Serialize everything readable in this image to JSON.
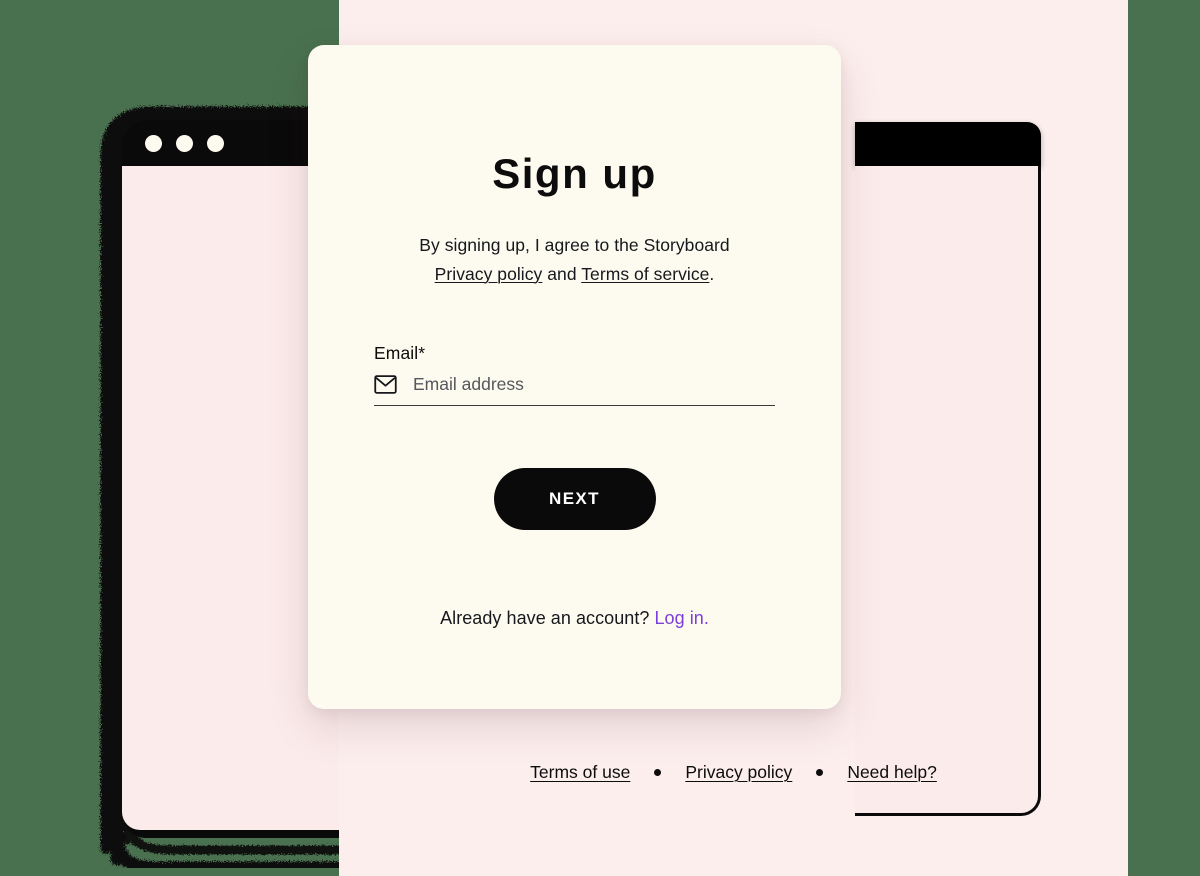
{
  "theme": {
    "page_background": "#4a714f",
    "panel_background": "#fdeeee",
    "card_background": "#fdfbef",
    "window_chrome": "#0a0a0a",
    "screen_background": "#fcebeb",
    "text_primary": "#0c0c0c",
    "link_accent": "#7b3fdc",
    "button_background": "#0a0a0a",
    "button_text": "#ffffff"
  },
  "back_window": {
    "name": "browser-window-back",
    "traffic_lights": [
      "close",
      "minimize",
      "maximize"
    ]
  },
  "front_window": {
    "name": "browser-window-front"
  },
  "card": {
    "title": "Sign up",
    "legal": {
      "lead": "By signing up, I agree to the Storyboard",
      "privacy_link": "Privacy policy",
      "conjunction": "and",
      "terms_link": "Terms of service",
      "period": "."
    },
    "email_field": {
      "label": "Email*",
      "icon": "mail-icon",
      "placeholder": "Email address",
      "value": ""
    },
    "next_button": {
      "label": "NEXT"
    },
    "account_prompt": {
      "text": "Already have an account?",
      "link": "Log in."
    }
  },
  "page_footer": {
    "links": [
      {
        "label": "Terms of use"
      },
      {
        "label": "Privacy policy"
      },
      {
        "label": "Need help?"
      }
    ],
    "separator": "•"
  }
}
